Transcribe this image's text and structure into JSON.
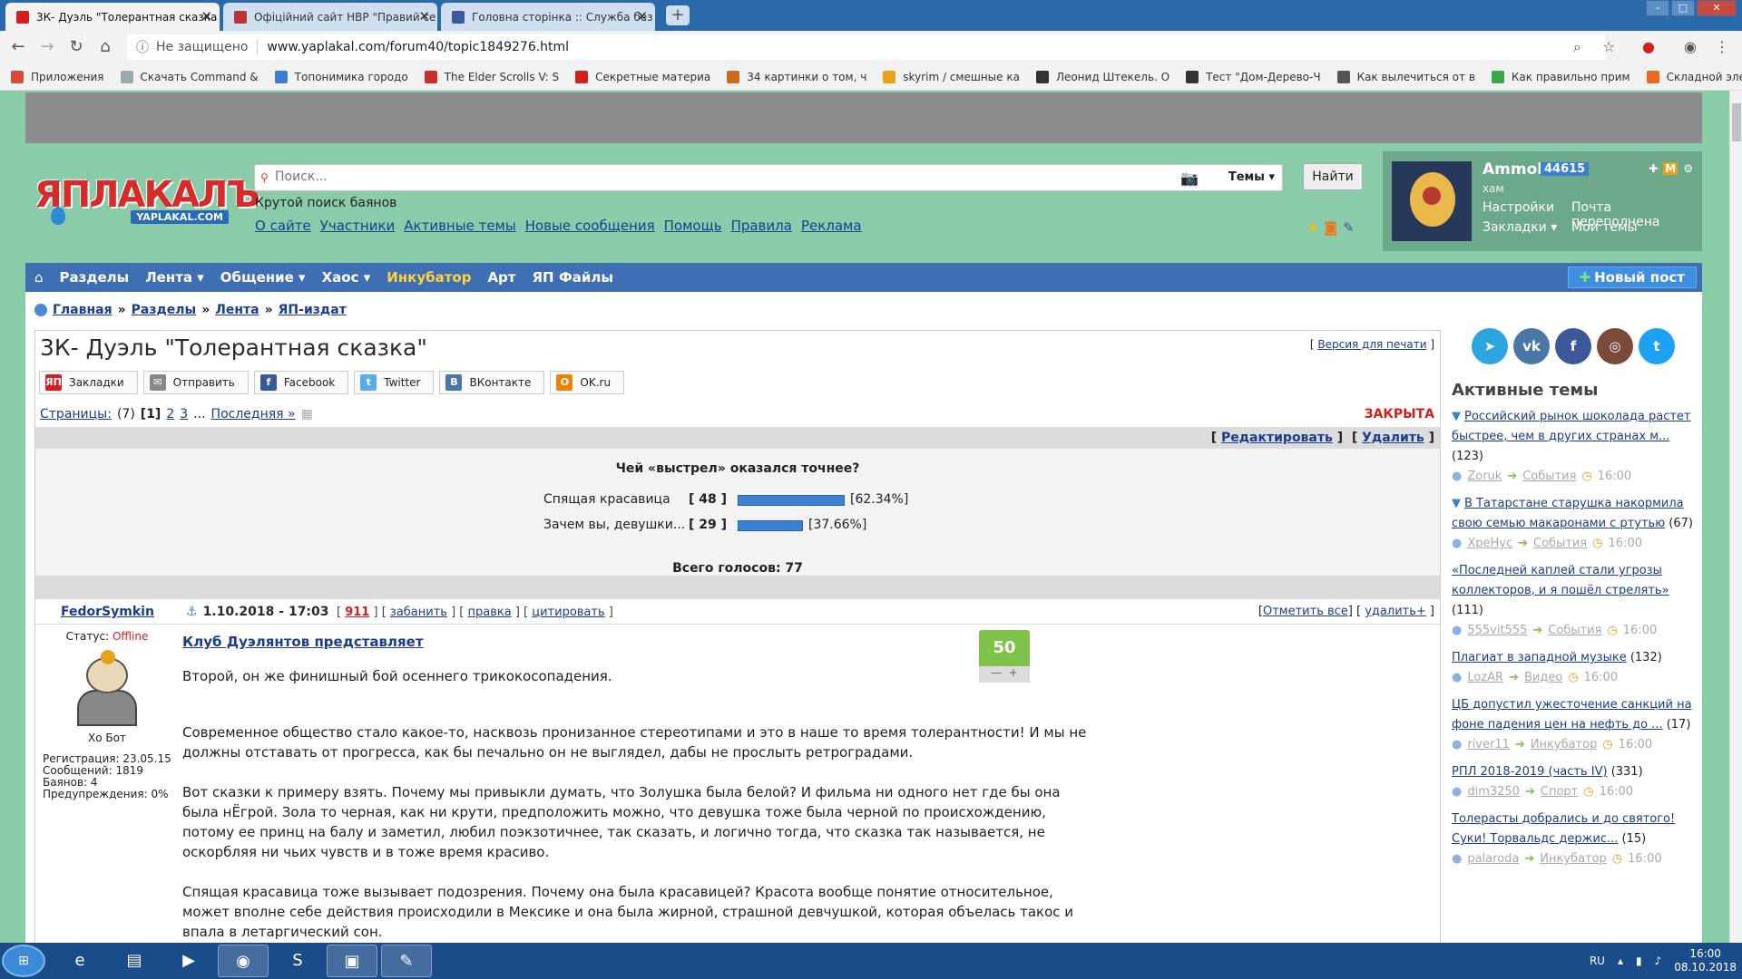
{
  "browser": {
    "tabs": [
      {
        "title": "3К- Дуэль \"Толерантная сказка",
        "active": true
      },
      {
        "title": "Офіційний сайт НВР \"Правий се",
        "active": false
      },
      {
        "title": "Головна сторінка :: Служба без",
        "active": false
      }
    ],
    "security_label": "Не защищено",
    "url": "www.yaplakal.com/forum40/topic1849276.html",
    "bookmarks": [
      {
        "label": "Приложения",
        "color": "#d84b3c"
      },
      {
        "label": "Скачать Command &",
        "color": "#9aa"
      },
      {
        "label": "Топонимика городо",
        "color": "#3b7fd1"
      },
      {
        "label": "The Elder Scrolls V: S",
        "color": "#c8302a"
      },
      {
        "label": "Секретные материа",
        "color": "#d02020"
      },
      {
        "label": "34 картинки о том, ч",
        "color": "#c86a20"
      },
      {
        "label": "skyrim / смешные ка",
        "color": "#e8a21a"
      },
      {
        "label": "Леонид Штекель. О",
        "color": "#333"
      },
      {
        "label": "Тест \"Дом-Дерево-Ч",
        "color": "#333"
      },
      {
        "label": "Как вылечиться от в",
        "color": "#555"
      },
      {
        "label": "Как правильно прим",
        "color": "#3aa84a"
      },
      {
        "label": "Складной электрове",
        "color": "#e86a20"
      }
    ]
  },
  "header": {
    "logo_text": "ЯПЛАКАЛЪ",
    "logo_domain": "YAPLAKAL.COM",
    "search_placeholder": "Поиск...",
    "themes_label": "Темы",
    "find_button": "Найти",
    "tagline": "Крутой поиск баянов",
    "links": [
      "О сайте",
      "Участники",
      "Активные темы",
      "Новые сообщения",
      "Помощь",
      "Правила",
      "Реклама"
    ]
  },
  "user": {
    "name": "Ammok",
    "count": "44615",
    "rank": "хам",
    "links": [
      "Настройки",
      "Почта переполнена",
      "Закладки",
      "Мои темы"
    ]
  },
  "menu": {
    "items": [
      "Разделы",
      "Лента",
      "Общение",
      "Хаос",
      "Инкубатор",
      "Арт",
      "ЯП Файлы"
    ],
    "new_post": "Новый пост"
  },
  "breadcrumbs": [
    "Главная",
    "Разделы",
    "Лента",
    "ЯП-издат"
  ],
  "topic": {
    "title": "3К- Дуэль \"Толерантная сказка\"",
    "print_version": "Версия для печати",
    "share": [
      {
        "label": "Закладки",
        "icon": "ЯП",
        "color": "#d02020"
      },
      {
        "label": "Отправить",
        "icon": "✉",
        "color": "#888"
      },
      {
        "label": "Facebook",
        "icon": "f",
        "color": "#3b5998"
      },
      {
        "label": "Twitter",
        "icon": "t",
        "color": "#55acee"
      },
      {
        "label": "ВКонтакте",
        "icon": "В",
        "color": "#4a76a8"
      },
      {
        "label": "OK.ru",
        "icon": "О",
        "color": "#ee8208"
      }
    ],
    "pages_label": "Страницы:",
    "pages_count": "(7)",
    "current_page": "[1]",
    "pages": [
      "2",
      "3"
    ],
    "last_page": "Последняя »",
    "status": "ЗАКРЫТА",
    "edit": "Редактировать",
    "delete": "Удалить"
  },
  "poll": {
    "question": "Чей «выстрел» оказался точнее?",
    "options": [
      {
        "label": "Спящая красавица",
        "votes": "48",
        "percent": "62.34",
        "percent_label": "[62.34%]"
      },
      {
        "label": "Зачем вы, девушки...",
        "votes": "29",
        "percent": "37.66",
        "percent_label": "[37.66%]"
      }
    ],
    "total": "Всего голосов: 77"
  },
  "post": {
    "author": "FedorSymkin",
    "date": "1.10.2018 - 17:03",
    "rating_link": "911",
    "actions": [
      "забанить",
      "правка",
      "цитировать"
    ],
    "right_actions": [
      "Отметить все",
      "удалить+"
    ],
    "status_label": "Статус:",
    "status_value": "Offline",
    "avatar_caption": "Хо Бот",
    "stats": [
      "Регистрация: 23.05.15",
      "Сообщений: 1819",
      "Баянов: 4",
      "Предупреждения: 0%"
    ],
    "rating": "50",
    "title": "Клуб Дуэлянтов представляет",
    "paragraphs": [
      "Второй, он же финишный бой осеннего трикокосопадения.",
      "Современное общество стало какое-то, насквозь пронизанное стереотипами и это в наше то время толерантности! И мы не должны отставать от прогресса, как бы печально он не выглядел, дабы не прослыть ретроградами.",
      "Вот сказки к примеру взять. Почему мы привыкли думать, что Золушка была белой? И фильма ни одного нет где бы она была нЁгрой. Зола то черная, как ни крути, предположить можно, что девушка тоже была черной по происхождению, потому ее принц на балу и заметил, любил поэкзотичнее, так сказать, и логично тогда, что сказка так называется, не оскорбляя ни чьих чувств и в тоже время красиво.",
      "Спящая красавица тоже вызывает подозрения. Почему она была красавицей? Красота вообще понятие относительное, может вполне себе действия происходили в Мексике и она была жирной, страшной девчушкой, которая объелась такос и впала в летаргический сон."
    ]
  },
  "sidebar": {
    "social": [
      {
        "name": "telegram",
        "glyph": "➤",
        "color": "#2ca5e0"
      },
      {
        "name": "vk",
        "glyph": "vk",
        "color": "#4a76a8"
      },
      {
        "name": "facebook",
        "glyph": "f",
        "color": "#3b5998"
      },
      {
        "name": "instagram",
        "glyph": "◎",
        "color": "#7a4a3a"
      },
      {
        "name": "twitter",
        "glyph": "t",
        "color": "#1da1f2"
      }
    ],
    "active_title": "Активные темы",
    "topics": [
      {
        "title": "Российский рынок шоколада растет быстрее, чем в других странах м...",
        "count": "(123)",
        "user": "Zoruk",
        "section": "События",
        "time": "16:00",
        "pinned": true
      },
      {
        "title": "В Татарстане старушка накормила свою семью макаронами с ртутью",
        "count": "(67)",
        "user": "ХреНус",
        "section": "События",
        "time": "16:00",
        "pinned": true
      },
      {
        "title": "«Последней каплей стали угрозы коллекторов, и я пошёл стрелять»",
        "count": "(111)",
        "user": "555vit555",
        "section": "События",
        "time": "16:00",
        "pinned": false
      },
      {
        "title": "Плагиат в западной музыке",
        "count": "(132)",
        "user": "LozAR",
        "section": "Видео",
        "time": "16:00",
        "pinned": false
      },
      {
        "title": "ЦБ допустил ужесточение санкций на фоне падения цен на нефть до ...",
        "count": "(17)",
        "user": "river11",
        "section": "Инкубатор",
        "time": "16:00",
        "pinned": false
      },
      {
        "title": "РПЛ 2018-2019 (часть IV)",
        "count": "(331)",
        "user": "dim3250",
        "section": "Спорт",
        "time": "16:00",
        "pinned": false
      },
      {
        "title": "Толерасты добрались и до святого! Суки! Торвальдс держис...",
        "count": "(15)",
        "user": "palaroda",
        "section": "Инкубатор",
        "time": "16:00",
        "pinned": false
      }
    ]
  },
  "taskbar": {
    "lang": "RU",
    "time": "16:00",
    "date": "08.10.2018"
  }
}
